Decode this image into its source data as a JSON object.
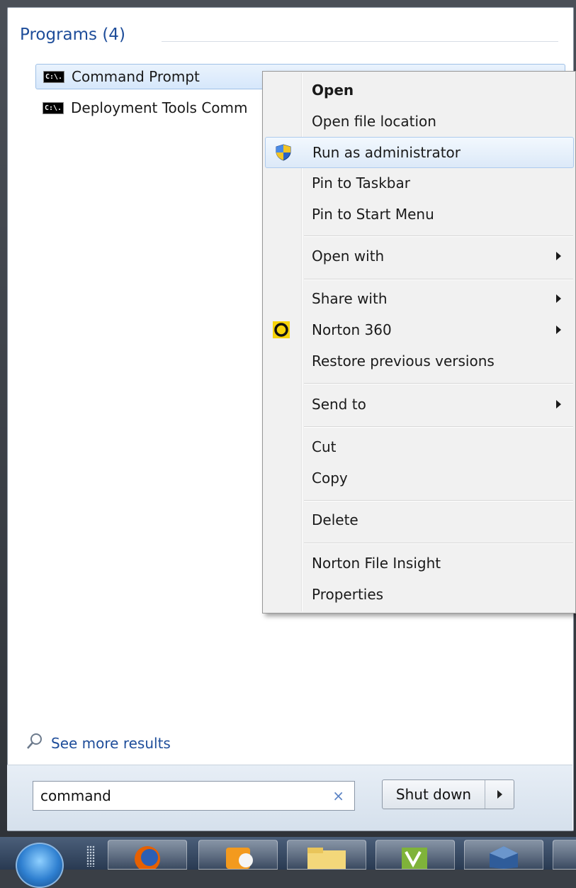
{
  "programs": {
    "header": "Programs (4)",
    "items": [
      {
        "label": "Command Prompt",
        "icon": "cmd-icon",
        "icon_text": "C:\\."
      },
      {
        "label": "Deployment Tools Comm",
        "icon": "cmd-icon",
        "icon_text": "C:\\."
      }
    ]
  },
  "context_menu": {
    "items": [
      {
        "label": "Open",
        "bold": true
      },
      {
        "label": "Open file location"
      },
      {
        "label": "Run as administrator",
        "icon": "uac-shield-icon",
        "hover": true
      },
      {
        "label": "Pin to Taskbar"
      },
      {
        "label": "Pin to Start Menu"
      },
      {
        "label": "Open with",
        "submenu": true
      },
      {
        "label": "Share with",
        "submenu": true
      },
      {
        "label": "Norton 360",
        "icon": "norton-icon",
        "submenu": true
      },
      {
        "label": "Restore previous versions"
      },
      {
        "label": "Send to",
        "submenu": true
      },
      {
        "label": "Cut"
      },
      {
        "label": "Copy"
      },
      {
        "label": "Delete"
      },
      {
        "label": "Norton File Insight"
      },
      {
        "label": "Properties"
      }
    ]
  },
  "see_more": {
    "label": "See more results",
    "icon": "magnifier-icon"
  },
  "search": {
    "value": "command",
    "clear_label": "×"
  },
  "shutdown": {
    "label": "Shut down"
  },
  "colors": {
    "link_blue": "#1e4d9a",
    "hover_bg": "#dce9f8",
    "menu_bg": "#f1f1f1",
    "norton_yellow": "#f7d30a"
  },
  "taskbar": {
    "items": [
      "start-orb",
      "firefox-icon",
      "outlook-icon",
      "explorer-icon",
      "vmware-icon",
      "virtualbox-icon"
    ]
  }
}
